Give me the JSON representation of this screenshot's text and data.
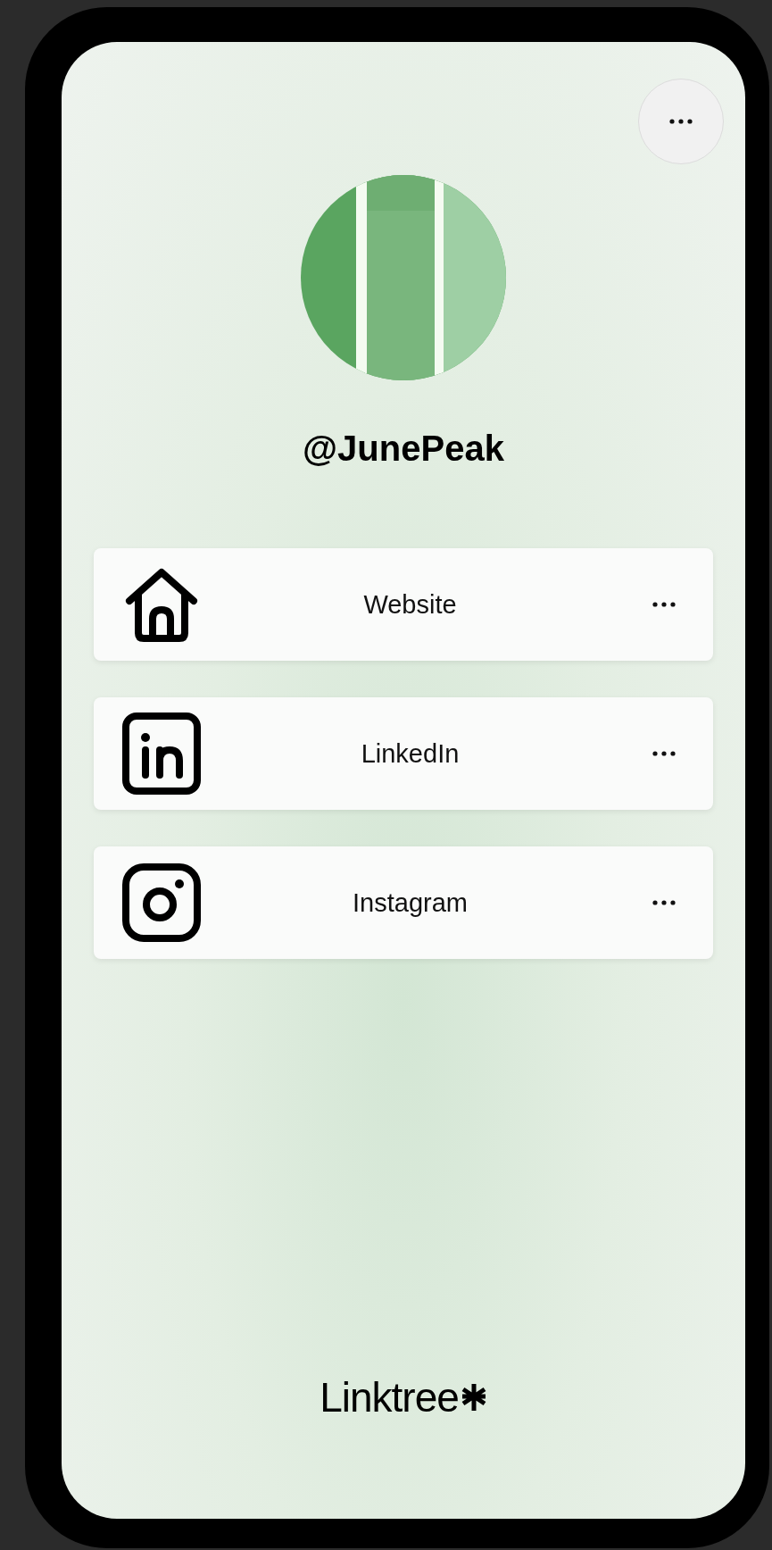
{
  "profile": {
    "username": "@JunePeak"
  },
  "links": [
    {
      "label": "Website",
      "kind": "home"
    },
    {
      "label": "LinkedIn",
      "kind": "linkedin"
    },
    {
      "label": "Instagram",
      "kind": "instagram"
    }
  ],
  "footer": {
    "brand": "Linktree"
  }
}
